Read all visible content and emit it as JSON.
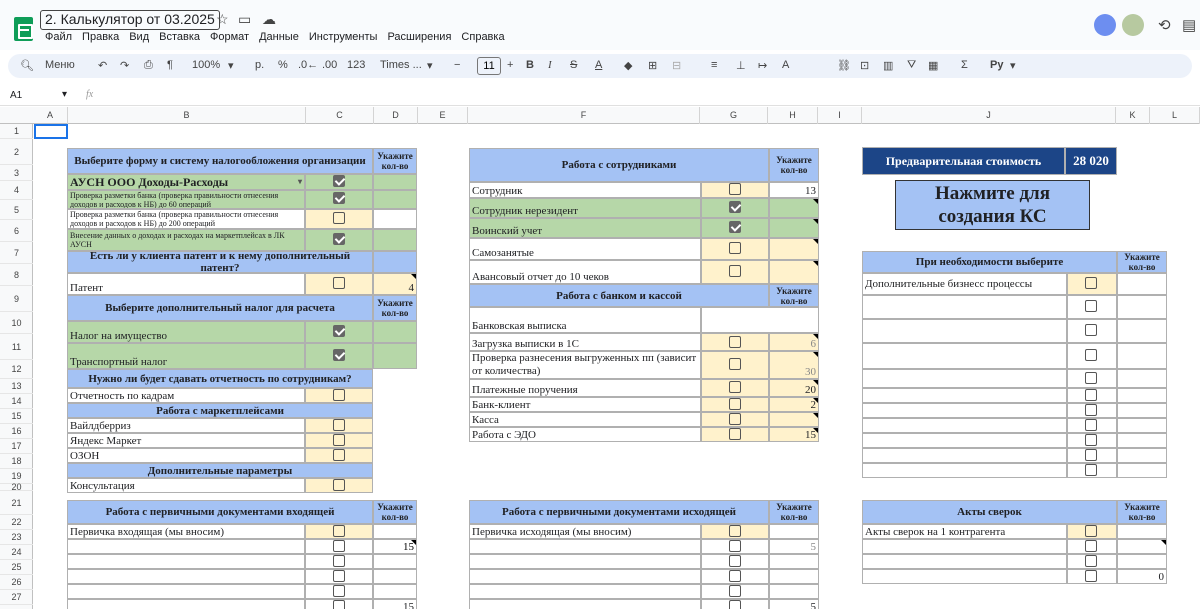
{
  "app": {
    "title": "2. Калькулятор от 03.2025"
  },
  "menu": [
    "Файл",
    "Правка",
    "Вид",
    "Вставка",
    "Формат",
    "Данные",
    "Инструменты",
    "Расширения",
    "Справка"
  ],
  "toolbar": {
    "menu_label": "Меню",
    "zoom": "100%",
    "currency": "р.",
    "percent": "%",
    "dec_less": ".0←",
    "dec_more": ".00",
    "format123": "123",
    "font": "Times ...",
    "font_size": "11",
    "input_tools": "Ру"
  },
  "formula_bar": {
    "cell_ref": "A1",
    "fx": "fx"
  },
  "columns": [
    "A",
    "B",
    "C",
    "D",
    "E",
    "F",
    "G",
    "H",
    "I",
    "J",
    "K",
    "L"
  ],
  "rows": [
    "1",
    "2",
    "3",
    "4",
    "5",
    "6",
    "7",
    "8",
    "9",
    "10",
    "11",
    "12",
    "13",
    "14",
    "15",
    "16",
    "17",
    "18",
    "19",
    "20",
    "21",
    "22",
    "23",
    "24",
    "25",
    "26",
    "27"
  ],
  "left": {
    "tax_header": "Выберите форму и систему налогообложения организации",
    "qty_label": "Укажите кол-во",
    "tax_system": "АУСН ООО Доходы-Расходы",
    "bank1": "Проверка разметки банка (проверка правильности отнесения доходов и расходов к НБ) до 60 операций",
    "bank2": "Проверка разметки банка (проверка правильности отнесения доходов и расходов к НБ) до 200 операций",
    "marketplace_data": "Внесение данных о доходах и расходах на маркетплейсах в ЛК АУСН",
    "patent_q": "Есть ли у клиента патент и к нему дополнительный патент?",
    "patent": "Патент",
    "patent_qty": "4",
    "addtax_header": "Выберите дополнительный налог для расчета",
    "property_tax": "Налог на имущество",
    "transport_tax": "Транспортный налог",
    "staff_q": "Нужно ли будет сдавать отчетность по сотрудникам?",
    "hr_reports": "Отчетность по кадрам",
    "mp_header": "Работа с маркетплейсами",
    "wb": "Вайлдберриз",
    "ym": "Яндекс Маркет",
    "ozon": "ОЗОН",
    "extra_header": "Дополнительные параметры",
    "consult": "Консультация",
    "in_docs_header": "Работа с первичными документами входящей",
    "in_docs": "Первичка входящая (мы вносим)",
    "in_qty1": "15",
    "in_qty2": "15"
  },
  "middle": {
    "staff_header": "Работа с сотрудниками",
    "qty_label": "Укажите кол-во",
    "employee": "Сотрудник",
    "employee_qty": "13",
    "nonresident": "Сотрудник нерезидент",
    "military": "Воинский учет",
    "selfemployed": "Самозанятые",
    "advance": "Авансовый отчет до 10 чеков",
    "bank_header": "Работа с банком и кассой",
    "statement": "Банковская выписка",
    "upload": "Загрузка выписки в 1С",
    "upload_qty": "6",
    "posting": "Проверка разнесения выгруженных пп (зависит от количества)",
    "posting_qty": "30",
    "payments": "Платежные поручения",
    "payments_qty": "20",
    "bankclient": "Банк-клиент",
    "bankclient_qty": "2",
    "cash": "Касса",
    "edo": "Работа с ЭДО",
    "edo_qty": "15",
    "out_docs_header": "Работа с первичными документами исходящей",
    "out_docs": "Первичка исходящая (мы вносим)",
    "out_qty1": "5",
    "out_qty2": "5"
  },
  "right": {
    "price_label": "Предварительная стоимость",
    "price_value": "28 020",
    "ks_button": "Нажмите для создания КС",
    "extra_header": "При необходимости выберите",
    "qty_label": "Укажите кол-во",
    "business": "Дополнительные бизнесс процессы",
    "acts_header": "Акты сверок",
    "acts": "Акты сверок на 1 контрагента",
    "acts_qty": "0"
  },
  "colors": {
    "header_blue": "#a4c2f4",
    "green": "#b6d7a8",
    "yellow": "#fff2cc",
    "price_bg": "#1c4587",
    "sheets_green": "#0f9d58"
  }
}
